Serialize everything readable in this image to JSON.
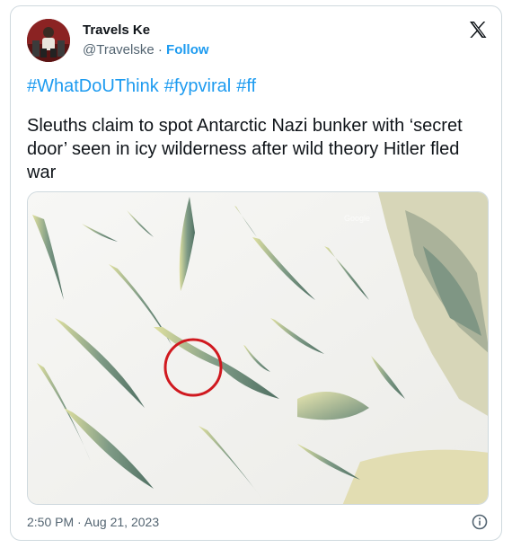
{
  "author": {
    "name": "Travels Ke",
    "handle": "@Travelske",
    "separator": " · ",
    "follow_label": "Follow",
    "avatar_icon": "profile-photo"
  },
  "brand": {
    "logo": "x-logo-icon",
    "color": "#0f1419"
  },
  "tweet": {
    "hashtags": [
      "#WhatDoUThink",
      "#fypviral",
      "#ff"
    ],
    "text": "Sleuths claim to spot Antarctic Nazi bunker with ‘secret door’ seen in icy wilderness after wild theory Hitler fled war"
  },
  "media": {
    "description_icon": "satellite-image",
    "highlight_color": "#d0191f",
    "watermark": "Google"
  },
  "meta": {
    "timestamp": "2:50 PM · Aug 21, 2023",
    "info_icon": "info-icon"
  },
  "colors": {
    "accent": "#1d9bf0",
    "text": "#0f1419",
    "secondary": "#536471",
    "border": "#cfd9de"
  }
}
